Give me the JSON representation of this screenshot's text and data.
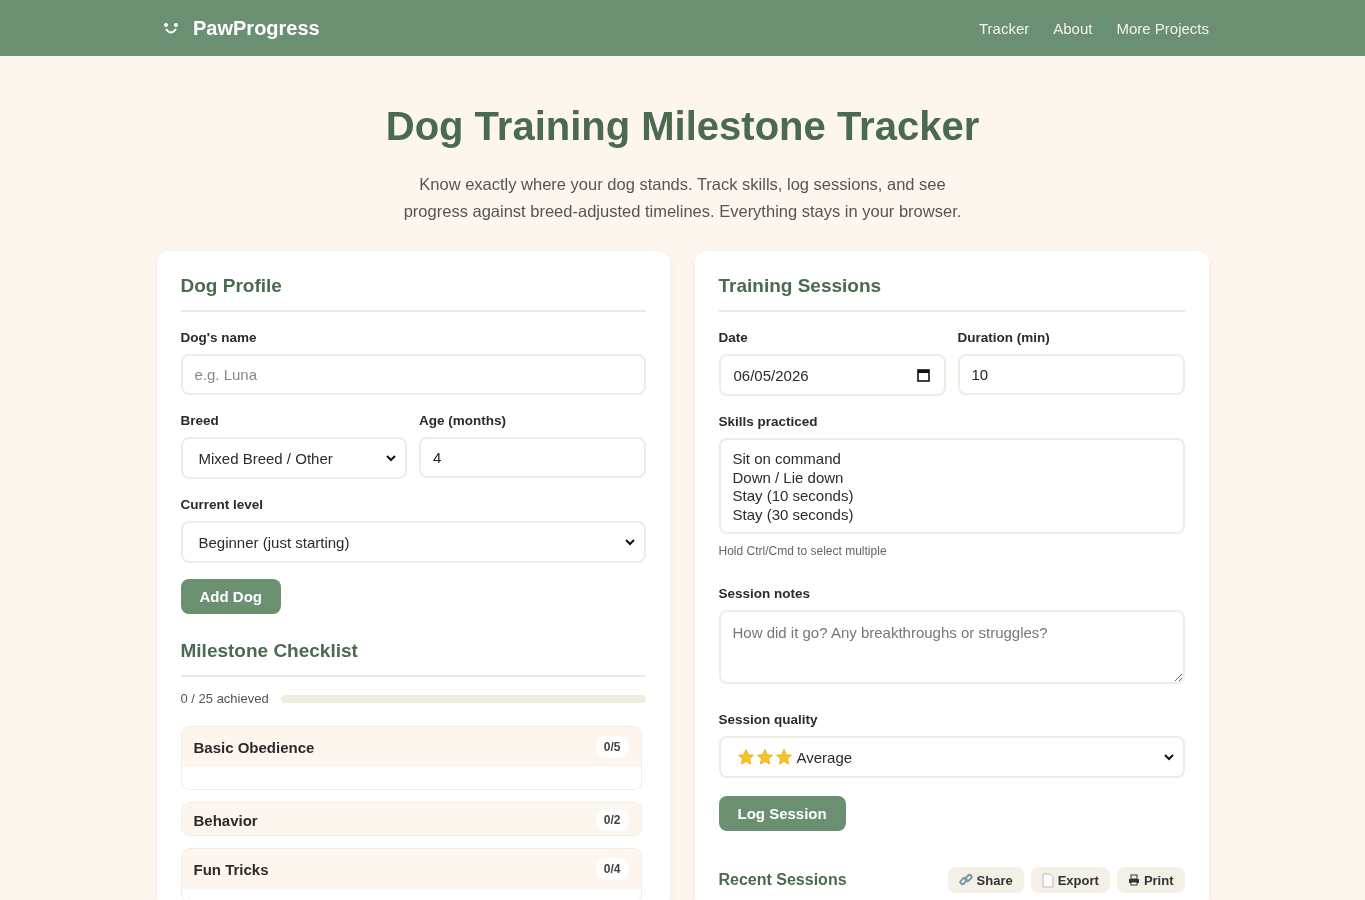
{
  "nav": {
    "brand": "PawProgress",
    "links": [
      {
        "label": "Tracker"
      },
      {
        "label": "About"
      },
      {
        "label": "More Projects"
      }
    ]
  },
  "hero": {
    "title": "Dog Training Milestone Tracker",
    "subtitle": "Know exactly where your dog stands. Track skills, log sessions, and see progress against breed-adjusted timelines. Everything stays in your browser."
  },
  "profile": {
    "title": "Dog Profile",
    "name_label": "Dog's name",
    "name_placeholder": "e.g. Luna",
    "breed_label": "Breed",
    "breed_value": "Mixed Breed / Other",
    "age_label": "Age (months)",
    "age_value": "4",
    "level_label": "Current level",
    "level_value": "Beginner (just starting)",
    "add_button": "Add Dog"
  },
  "checklist": {
    "title": "Milestone Checklist",
    "achieved": "0 / 25 achieved",
    "level": 0,
    "groups": [
      {
        "name": "Basic Obedience",
        "count": "0/5",
        "expanded": true
      },
      {
        "name": "Behavior",
        "count": "0/2",
        "expanded": false
      },
      {
        "name": "Fun Tricks",
        "count": "0/4",
        "expanded": true
      }
    ]
  },
  "sessions": {
    "title": "Training Sessions",
    "date_label": "Date",
    "date_value": "06/05/2026",
    "duration_label": "Duration (min)",
    "duration_value": "10",
    "skills_label": "Skills practiced",
    "skills": [
      {
        "label": "Sit on command",
        "selected": false
      },
      {
        "label": "Down / Lie down",
        "selected": false
      },
      {
        "label": "Stay (10 seconds)",
        "selected": false
      },
      {
        "label": "Stay (30 seconds)",
        "selected": false
      }
    ],
    "skills_hint": "Hold Ctrl/Cmd to select multiple",
    "notes_label": "Session notes",
    "notes_placeholder": "How did it go? Any breakthroughs or struggles?",
    "quality_label": "Session quality",
    "quality": {
      "stars": 3,
      "label": "Average"
    },
    "log_button": "Log Session",
    "recent_title": "Recent Sessions",
    "actions": [
      {
        "kind": "share",
        "label": "Share"
      },
      {
        "kind": "export",
        "label": "Export"
      },
      {
        "kind": "print",
        "label": "Print"
      }
    ]
  }
}
